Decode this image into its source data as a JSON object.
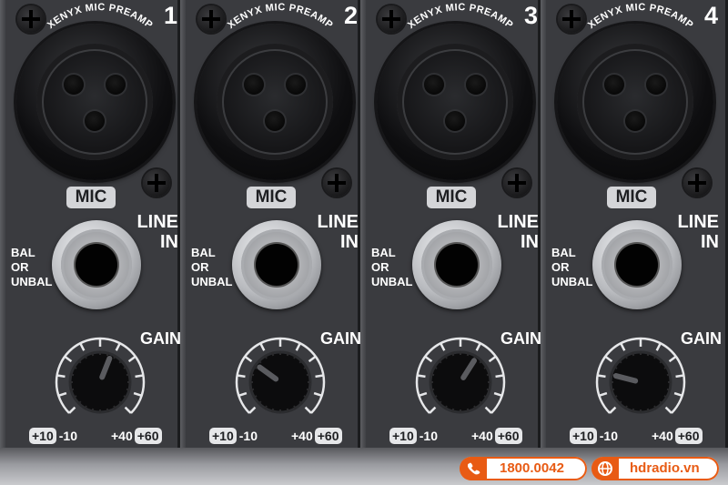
{
  "channels": [
    {
      "number": "1",
      "brand": "XENYX MIC PREAMP",
      "mic_label": "MIC",
      "line_in": [
        "LINE",
        "IN"
      ],
      "bal": [
        "BAL",
        "OR",
        "UNBAL"
      ],
      "gain_label": "GAIN",
      "gain_min_pad": "+10",
      "gain_min_line": "-10",
      "gain_max_line": "+40",
      "gain_max_pad": "+60",
      "knob_level": 0.58
    },
    {
      "number": "2",
      "brand": "XENYX MIC PREAMP",
      "mic_label": "MIC",
      "line_in": [
        "LINE",
        "IN"
      ],
      "bal": [
        "BAL",
        "OR",
        "UNBAL"
      ],
      "gain_label": "GAIN",
      "gain_min_pad": "+10",
      "gain_min_line": "-10",
      "gain_max_line": "+40",
      "gain_max_pad": "+60",
      "knob_level": 0.3
    },
    {
      "number": "3",
      "brand": "XENYX MIC PREAMP",
      "mic_label": "MIC",
      "line_in": [
        "LINE",
        "IN"
      ],
      "bal": [
        "BAL",
        "OR",
        "UNBAL"
      ],
      "gain_label": "GAIN",
      "gain_min_pad": "+10",
      "gain_min_line": "-10",
      "gain_max_line": "+40",
      "gain_max_pad": "+60",
      "knob_level": 0.62
    },
    {
      "number": "4",
      "brand": "XENYX MIC PREAMP",
      "mic_label": "MIC",
      "line_in": [
        "LINE",
        "IN"
      ],
      "bal": [
        "BAL",
        "OR",
        "UNBAL"
      ],
      "gain_label": "GAIN",
      "gain_min_pad": "+10",
      "gain_min_line": "-10",
      "gain_max_line": "+40",
      "gain_max_pad": "+60",
      "knob_level": 0.22
    }
  ],
  "contacts": {
    "phone": "1800.0042",
    "website": "hdradio.vn",
    "phone_icon": "phone-icon",
    "web_icon": "globe-icon"
  },
  "colors": {
    "panel": "#3a3b3f",
    "accent": "#e85b14",
    "label_pill": "#d4d5d8"
  }
}
